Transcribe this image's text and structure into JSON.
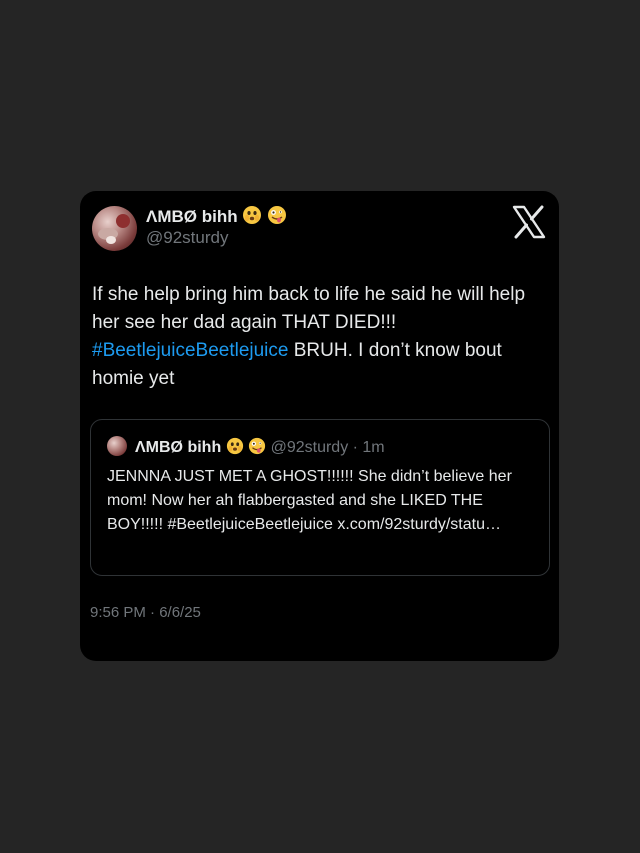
{
  "tweet": {
    "display_name": "ΛMBØ bihh",
    "emojis": [
      "face-holding-back-tears-emoji",
      "zany-face-emoji"
    ],
    "handle": "@92sturdy",
    "text_part1": "If she help bring him back to life he said he will help her see her dad again THAT DIED!!!",
    "hashtag": "#BeetlejuiceBeetlejuice",
    "text_part2": "BRUH. I don’t know bout homie yet",
    "timestamp": "9:56 PM · 6/6/25"
  },
  "quote": {
    "display_name": "ΛMBØ bihh",
    "handle": "@92sturdy",
    "time_ago": "1m",
    "text": "JENNNA JUST MET A GHOST!!!!!! She didn’t believe her mom! Now her ah flabbergasted and she LIKED THE BOY!!!!! #BeetlejuiceBeetlejuice x.com/92sturdy/statu…"
  },
  "icons": {
    "brand": "x-logo-icon"
  },
  "colors": {
    "background": "#252525",
    "card": "#000000",
    "hashtag": "#1d9bf0",
    "secondary_text": "#71767b"
  }
}
